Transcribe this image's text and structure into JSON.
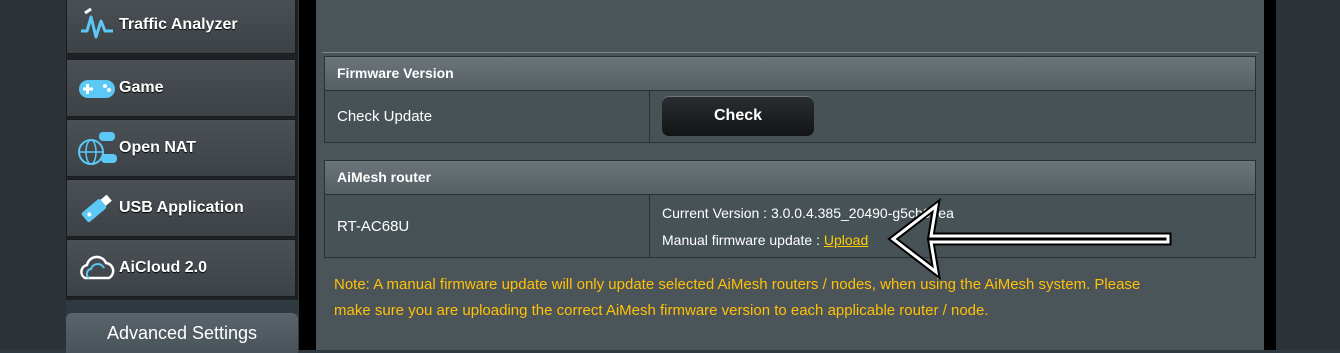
{
  "sidebar": {
    "items": [
      {
        "label": "Traffic Analyzer",
        "icon": "traffic-analyzer-icon"
      },
      {
        "label": "Game",
        "icon": "gamepad-icon"
      },
      {
        "label": "Open NAT",
        "icon": "globe-gamepad-icon"
      },
      {
        "label": "USB Application",
        "icon": "usb-drive-icon"
      },
      {
        "label": "AiCloud 2.0",
        "icon": "cloud-icon"
      }
    ],
    "advanced_settings": "Advanced Settings"
  },
  "firmware": {
    "header": "Firmware Version",
    "check_label": "Check Update",
    "check_button": "Check"
  },
  "aimesh": {
    "header": "AiMesh router",
    "model": "RT-AC68U",
    "current_version": "Current Version : 3.0.0.4.385_20490-g5cb06ea",
    "manual_label": "Manual firmware update : ",
    "upload_link": "Upload"
  },
  "note": {
    "line1": "Note: A manual firmware update will only update selected AiMesh routers / nodes, when using the AiMesh system. Please",
    "line2": "make sure you are uploading the correct AiMesh firmware version to each applicable router / node."
  },
  "colors": {
    "note_text": "#ffc107",
    "upload_link": "#ffcc00",
    "panel_bg": "#4a5459"
  }
}
